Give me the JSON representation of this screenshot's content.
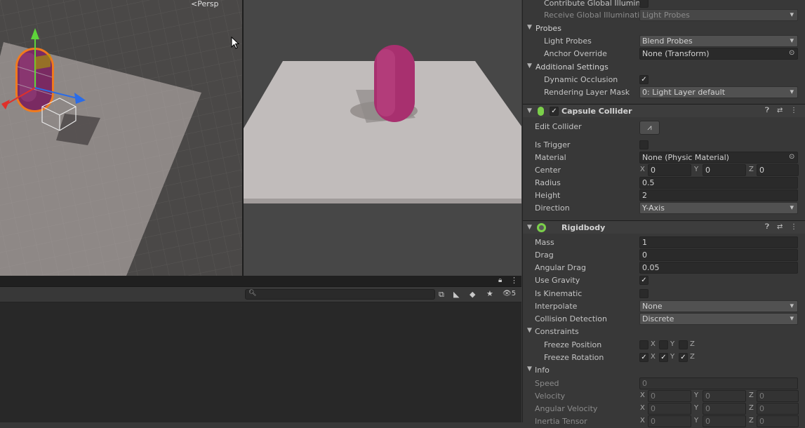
{
  "scene_view": {
    "mode_label": "<Persp"
  },
  "inspector": {
    "top": {
      "contribute_gi": "Contribute Global Illuminat",
      "receive_gi_label": "Receive Global Illuminatio",
      "receive_gi_value": "Light Probes"
    },
    "probes": {
      "header": "Probes",
      "light_probes_label": "Light Probes",
      "light_probes_value": "Blend Probes",
      "anchor_label": "Anchor Override",
      "anchor_value": "None (Transform)"
    },
    "additional": {
      "header": "Additional Settings",
      "dynamic_occlusion_label": "Dynamic Occlusion",
      "rendering_layer_label": "Rendering Layer Mask",
      "rendering_layer_value": "0: Light Layer default"
    },
    "capsule": {
      "title": "Capsule Collider",
      "edit_label": "Edit Collider",
      "trigger_label": "Is Trigger",
      "material_label": "Material",
      "material_value": "None (Physic Material)",
      "center_label": "Center",
      "center": {
        "x": "0",
        "y": "0",
        "z": "0"
      },
      "radius_label": "Radius",
      "radius_value": "0.5",
      "height_label": "Height",
      "height_value": "2",
      "direction_label": "Direction",
      "direction_value": "Y-Axis"
    },
    "rigidbody": {
      "title": "Rigidbody",
      "mass_label": "Mass",
      "mass_value": "1",
      "drag_label": "Drag",
      "drag_value": "0",
      "angular_drag_label": "Angular Drag",
      "angular_drag_value": "0.05",
      "gravity_label": "Use Gravity",
      "kinematic_label": "Is Kinematic",
      "interpolate_label": "Interpolate",
      "interpolate_value": "None",
      "collision_label": "Collision Detection",
      "collision_value": "Discrete",
      "constraints_header": "Constraints",
      "freeze_pos_label": "Freeze Position",
      "freeze_rot_label": "Freeze Rotation",
      "axis_x": "X",
      "axis_y": "Y",
      "axis_z": "Z",
      "info_header": "Info",
      "speed_label": "Speed",
      "speed_value": "0",
      "velocity_label": "Velocity",
      "velocity": {
        "x": "0",
        "y": "0",
        "z": "0"
      },
      "angular_velocity_label": "Angular Velocity",
      "angular_velocity": {
        "x": "0",
        "y": "0",
        "z": "0"
      },
      "inertia_label": "Inertia Tensor",
      "inertia": {
        "x": "0",
        "y": "0",
        "z": "0"
      }
    }
  },
  "bottom_panel": {
    "hidden_count": "5"
  },
  "colors": {
    "capsule": "#a8306f",
    "selection": "#f07a1e",
    "gizmo_x": "#e0302a",
    "gizmo_y": "#5ed43a",
    "gizmo_z": "#2a6ce8"
  }
}
